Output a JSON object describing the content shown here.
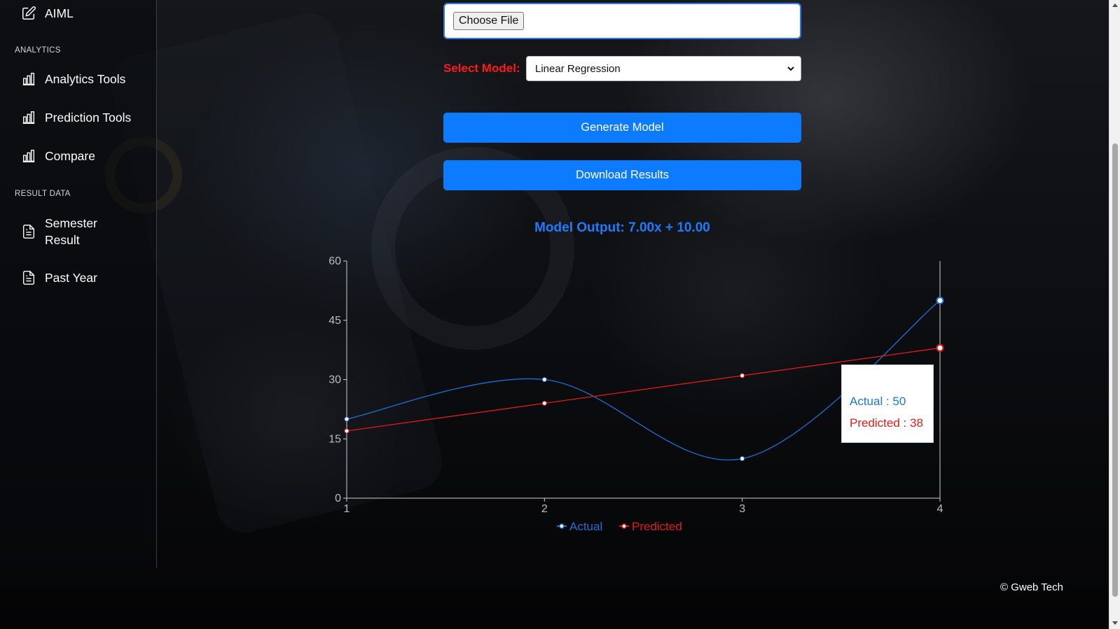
{
  "sidebar": {
    "top_item": {
      "label": "AIML",
      "icon": "edit-icon"
    },
    "sections": [
      {
        "title": "ANALYTICS",
        "items": [
          {
            "label": "Analytics Tools",
            "icon": "bar-chart-icon"
          },
          {
            "label": "Prediction Tools",
            "icon": "bar-chart-icon"
          },
          {
            "label": "Compare",
            "icon": "bar-chart-icon"
          }
        ]
      },
      {
        "title": "RESULT DATA",
        "items": [
          {
            "label": "Semester Result",
            "icon": "document-icon"
          },
          {
            "label": "Past Year",
            "icon": "document-icon"
          }
        ]
      }
    ]
  },
  "form": {
    "file_button": "Choose File",
    "select_label": "Select Model:",
    "select_value": "Linear Regression",
    "generate_button": "Generate Model",
    "download_button": "Download Results"
  },
  "model_output": "Model Output: 7.00x + 10.00",
  "chart_data": {
    "type": "line",
    "x": [
      1,
      2,
      3,
      4
    ],
    "series": [
      {
        "name": "Actual",
        "values": [
          20,
          30,
          10,
          50
        ],
        "color": "#1f6fd6"
      },
      {
        "name": "Predicted",
        "values": [
          17,
          24,
          31,
          38
        ],
        "color": "#e11b1b"
      }
    ],
    "ylim": [
      0,
      60
    ],
    "yticks": [
      0,
      15,
      30,
      45,
      60
    ],
    "legend": "bottom-center",
    "tooltip": {
      "actual": "Actual : 50",
      "predicted": "Predicted : 38"
    }
  },
  "footer": "© Gweb Tech"
}
